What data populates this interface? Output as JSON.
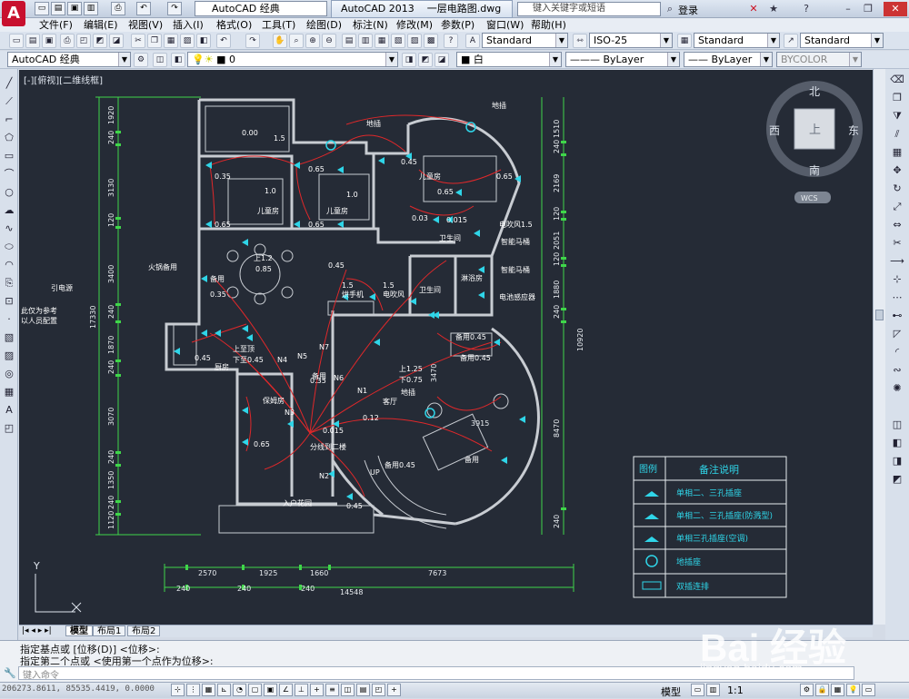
{
  "app": {
    "logo_letter": "A",
    "workspace": "AutoCAD 经典",
    "app_title": "AutoCAD 2013",
    "document": "一层电路图.dwg",
    "search_placeholder": "键入关键字或短语",
    "login": "登录"
  },
  "menu": [
    "文件(F)",
    "编辑(E)",
    "视图(V)",
    "插入(I)",
    "格式(O)",
    "工具(T)",
    "绘图(D)",
    "标注(N)",
    "修改(M)",
    "参数(P)",
    "窗口(W)",
    "帮助(H)"
  ],
  "styles_toolbar": {
    "text_style": "Standard",
    "dim_style": "ISO-25",
    "table_style": "Standard",
    "multileader_style": "Standard"
  },
  "layers_toolbar": {
    "workspace": "AutoCAD 经典",
    "layer": "0",
    "color": "白",
    "linetype": "ByLayer",
    "lineweight": "ByLayer",
    "plotstyle": "BYCOLOR"
  },
  "viewport_label": "[-][俯视][二维线框]",
  "viewcube": {
    "north": "北",
    "south": "南",
    "east": "东",
    "west": "西",
    "top": "上",
    "wcs": "WCS"
  },
  "ucs": {
    "y": "Y",
    "x": "X"
  },
  "drawing": {
    "left_dims": [
      "1920",
      "240",
      "3130",
      "120",
      "3400",
      "240",
      "1870",
      "240",
      "3070",
      "240",
      "1350",
      "240",
      "1120"
    ],
    "left_total": "17330",
    "right_dims": [
      "1510",
      "240",
      "2169",
      "120",
      "2051",
      "120",
      "1880",
      "240",
      "3470",
      "240"
    ],
    "right_total": "10920",
    "right_total2": "8470",
    "bottom_dims": [
      "2570",
      "1925",
      "1660",
      "7673"
    ],
    "bottom_dims2": [
      "240",
      "240",
      "240"
    ],
    "bottom_total": "14548",
    "mid_dim": "3915",
    "mid_dim_v": "3470",
    "labels": {
      "floor_socket1": "地插",
      "floor_socket2": "地插",
      "floor_socket3": "地插",
      "hotpot": "火锅备用",
      "lead": "引电源",
      "note1": "此仅为参考",
      "note2": "以人员配置",
      "kids_room1": "儿童房",
      "kids_room2": "儿童房",
      "kids_room3": "儿童房",
      "hairdryer": "电吹风1.5",
      "smart_toilet1": "智能马桶",
      "smart_toilet2": "智能马桶",
      "battery": "电池感应器",
      "dryer": "烘手机",
      "hairdryer2": "电吹风",
      "bathroom1": "卫生间",
      "bathroom2": "卫生间",
      "shower": "淋浴房",
      "kitchen": "厨房",
      "upstairs": "上至顶",
      "down": "下至0.45",
      "nanny": "保姆房",
      "living": "客厅",
      "branch": "分线到二楼",
      "entrance": "入户花园",
      "spare1": "备用",
      "spare2": "备用",
      "spare3": "备用0.45",
      "spare4": "备用0.45",
      "spare5": "备用0.45",
      "spare6": "备用",
      "up125": "上1.25",
      "down075": "下0.75",
      "n1": "N1",
      "n2": "N2",
      "n3": "N3",
      "n4": "N4",
      "n5": "N5",
      "n6": "N6",
      "n7": "N7",
      "up": "UP",
      "h035": "0.35",
      "h065": "0.65",
      "h10": "1.0",
      "h15": "1.5",
      "h045": "0.45",
      "h085": "0.85",
      "h12": "上1.2",
      "h012": "0.12",
      "h015": "0.015",
      "h003": "0.03",
      "h0015": "0.015",
      "h000": "0.00"
    }
  },
  "legend": {
    "col1": "图例",
    "col2": "备注说明",
    "rows": [
      "单相二、三孔插座",
      "单相二、三孔插座(防溅型)",
      "单相三孔插座(空调)",
      "地插座",
      "双插连排"
    ]
  },
  "layout_tabs": [
    "模型",
    "布局1",
    "布局2"
  ],
  "command": {
    "line1": "指定基点或 [位移(D)] <位移>:",
    "line2": "指定第二个点或 <使用第一个点作为位移>:",
    "prompt": "键入命令"
  },
  "status": {
    "coords": "206273.8611, 85535.4419, 0.0000",
    "model": "模型",
    "scale": "1:1"
  },
  "watermark": {
    "brand": "Bai 经验",
    "url": "jingyan.baidu.com"
  },
  "colors": {
    "canvas": "#252b36",
    "wall": "#c8ccd2",
    "dim": "#3fd64a",
    "circuit": "#e0282a",
    "socket": "#2fd5e8",
    "label": "#ffffff"
  }
}
